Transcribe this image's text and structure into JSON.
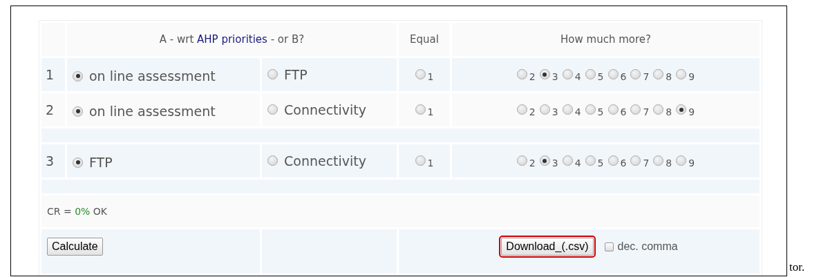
{
  "header": {
    "question_prefix": "A - wrt",
    "question_link": "AHP priorities",
    "question_suffix": "- or B?",
    "equal": "Equal",
    "more": "How much more?"
  },
  "groups": [
    [
      {
        "number": "1",
        "a": {
          "label": "on line assessment",
          "selected": true
        },
        "b": {
          "label": "FTP",
          "selected": false
        },
        "equal": {
          "label": "1",
          "selected": false
        },
        "scale": [
          {
            "label": "2",
            "selected": false
          },
          {
            "label": "3",
            "selected": true
          },
          {
            "label": "4",
            "selected": false
          },
          {
            "label": "5",
            "selected": false
          },
          {
            "label": "6",
            "selected": false
          },
          {
            "label": "7",
            "selected": false
          },
          {
            "label": "8",
            "selected": false
          },
          {
            "label": "9",
            "selected": false
          }
        ]
      },
      {
        "number": "2",
        "a": {
          "label": "on line assessment",
          "selected": true
        },
        "b": {
          "label": "Connectivity",
          "selected": false
        },
        "equal": {
          "label": "1",
          "selected": false
        },
        "scale": [
          {
            "label": "2",
            "selected": false
          },
          {
            "label": "3",
            "selected": false
          },
          {
            "label": "4",
            "selected": false
          },
          {
            "label": "5",
            "selected": false
          },
          {
            "label": "6",
            "selected": false
          },
          {
            "label": "7",
            "selected": false
          },
          {
            "label": "8",
            "selected": false
          },
          {
            "label": "9",
            "selected": true
          }
        ]
      }
    ],
    [
      {
        "number": "3",
        "a": {
          "label": "FTP",
          "selected": true
        },
        "b": {
          "label": "Connectivity",
          "selected": false
        },
        "equal": {
          "label": "1",
          "selected": false
        },
        "scale": [
          {
            "label": "2",
            "selected": false
          },
          {
            "label": "3",
            "selected": true
          },
          {
            "label": "4",
            "selected": false
          },
          {
            "label": "5",
            "selected": false
          },
          {
            "label": "6",
            "selected": false
          },
          {
            "label": "7",
            "selected": false
          },
          {
            "label": "8",
            "selected": false
          },
          {
            "label": "9",
            "selected": false
          }
        ]
      }
    ]
  ],
  "consistency": {
    "label": "CR =",
    "value": "0%",
    "status": "OK"
  },
  "calculate_button": "Calculate",
  "download_button": {
    "label": "Download_(.csv)",
    "highlighted": true
  },
  "dec_comma": {
    "label": "dec. comma",
    "checked": false
  },
  "trailing_text": "tor."
}
